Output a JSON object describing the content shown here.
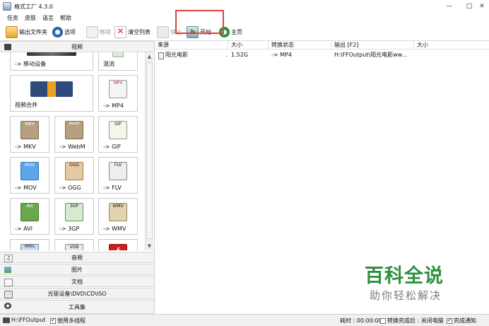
{
  "window": {
    "title": "格式工厂 4.3.0",
    "controls": [
      "—",
      "□",
      "✕"
    ]
  },
  "menu": [
    "任务",
    "皮肤",
    "语言",
    "帮助"
  ],
  "toolbar": {
    "output_folder": "输出文件夹",
    "options": "选项",
    "remove": "移除",
    "clear_list": "清空列表",
    "stop": "停止",
    "start": "开始",
    "home": "主页"
  },
  "left_panel": {
    "video_header": "视频",
    "tiles": [
      {
        "label": "-> 移动设备"
      },
      {
        "label": "混流"
      },
      {
        "label": "视频合并"
      },
      {
        "label": "-> MP4",
        "badge": "MP4"
      },
      {
        "label": "-> MKV",
        "badge": "MKV"
      },
      {
        "label": "-> WebM",
        "badge": "WebM"
      },
      {
        "label": "-> GIF",
        "badge": "GIF"
      },
      {
        "label": "-> MOV",
        "badge": "MOV"
      },
      {
        "label": "-> OGG",
        "badge": "OGG"
      },
      {
        "label": "-> FLV",
        "badge": "FLV"
      },
      {
        "label": "-> AVI",
        "badge": "AVI"
      },
      {
        "label": "-> 3GP",
        "badge": "3GP"
      },
      {
        "label": "-> WMV",
        "badge": "WMV"
      },
      {
        "label": "",
        "badge": "MPEG"
      },
      {
        "label": "",
        "badge": "VOB"
      },
      {
        "label": "",
        "badge": ""
      }
    ],
    "categories": [
      "音频",
      "图片",
      "文档",
      "光驱设备\\DVD\\CD\\ISO",
      "工具集"
    ]
  },
  "table": {
    "headers": [
      "来源",
      "大小",
      "转换状态",
      "输出 [F2]",
      "大小"
    ],
    "rows": [
      {
        "source": "阳光电影",
        "dot": ".",
        "size": "1.52G",
        "status": "-> MP4",
        "output": "H:\\FFOutput\\阳光电影ww...",
        "out_size": ""
      }
    ]
  },
  "status": {
    "path": "H:\\FFOutput",
    "multithread": "使用多线程",
    "elapsed": "耗时 : 00:00:00",
    "after_done": "转换完成后 : 关闭电脑",
    "notify": "完成通知"
  },
  "watermark": {
    "title": "百科全说",
    "subtitle": "助你轻松解决"
  },
  "colors": {
    "highlight": "#e04040",
    "watermark": "#2f8f3f"
  }
}
